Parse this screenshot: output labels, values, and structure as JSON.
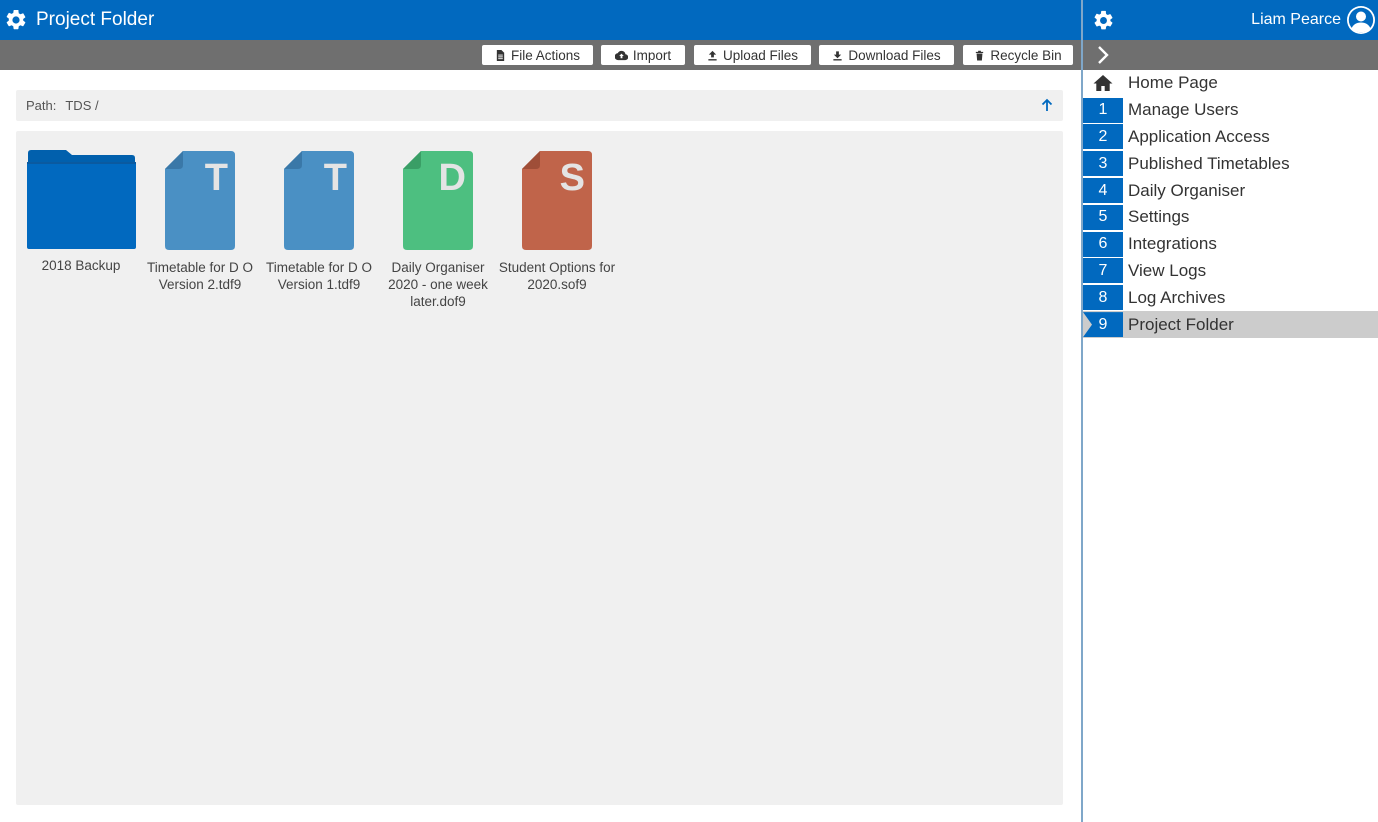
{
  "header": {
    "title": "Project Folder"
  },
  "toolbar": {
    "buttons": [
      {
        "label": "File Actions",
        "icon": "file-icon"
      },
      {
        "label": "Import",
        "icon": "cloud-upload-icon"
      },
      {
        "label": "Upload Files",
        "icon": "upload-icon"
      },
      {
        "label": "Download Files",
        "icon": "download-icon"
      },
      {
        "label": "Recycle Bin",
        "icon": "trash-icon"
      }
    ]
  },
  "path": {
    "label": "Path:",
    "value": "TDS /"
  },
  "files": [
    {
      "name": "2018 Backup",
      "type": "folder",
      "color": "#0169bf"
    },
    {
      "name": "Timetable for D O Version 2.tdf9",
      "type": "file",
      "letter": "T",
      "color": "#4a90c4"
    },
    {
      "name": "Timetable for D O Version 1.tdf9",
      "type": "file",
      "letter": "T",
      "color": "#4a90c4"
    },
    {
      "name": "Daily Organiser 2020 - one week later.dof9",
      "type": "file",
      "letter": "D",
      "color": "#4dbf80"
    },
    {
      "name": "Student Options for 2020.sof9",
      "type": "file",
      "letter": "S",
      "color": "#c0644a"
    }
  ],
  "user": {
    "name": "Liam Pearce"
  },
  "nav": {
    "home": "Home Page",
    "items": [
      {
        "num": "1",
        "label": "Manage Users"
      },
      {
        "num": "2",
        "label": "Application Access"
      },
      {
        "num": "3",
        "label": "Published Timetables"
      },
      {
        "num": "4",
        "label": "Daily Organiser"
      },
      {
        "num": "5",
        "label": "Settings"
      },
      {
        "num": "6",
        "label": "Integrations"
      },
      {
        "num": "7",
        "label": "View Logs"
      },
      {
        "num": "8",
        "label": "Log Archives"
      },
      {
        "num": "9",
        "label": "Project Folder"
      }
    ],
    "active": "9"
  },
  "colors": {
    "brand": "#0169bf",
    "toolbar": "#6f6f6f",
    "panel": "#f0f0f0",
    "active_nav": "#cccccc"
  }
}
